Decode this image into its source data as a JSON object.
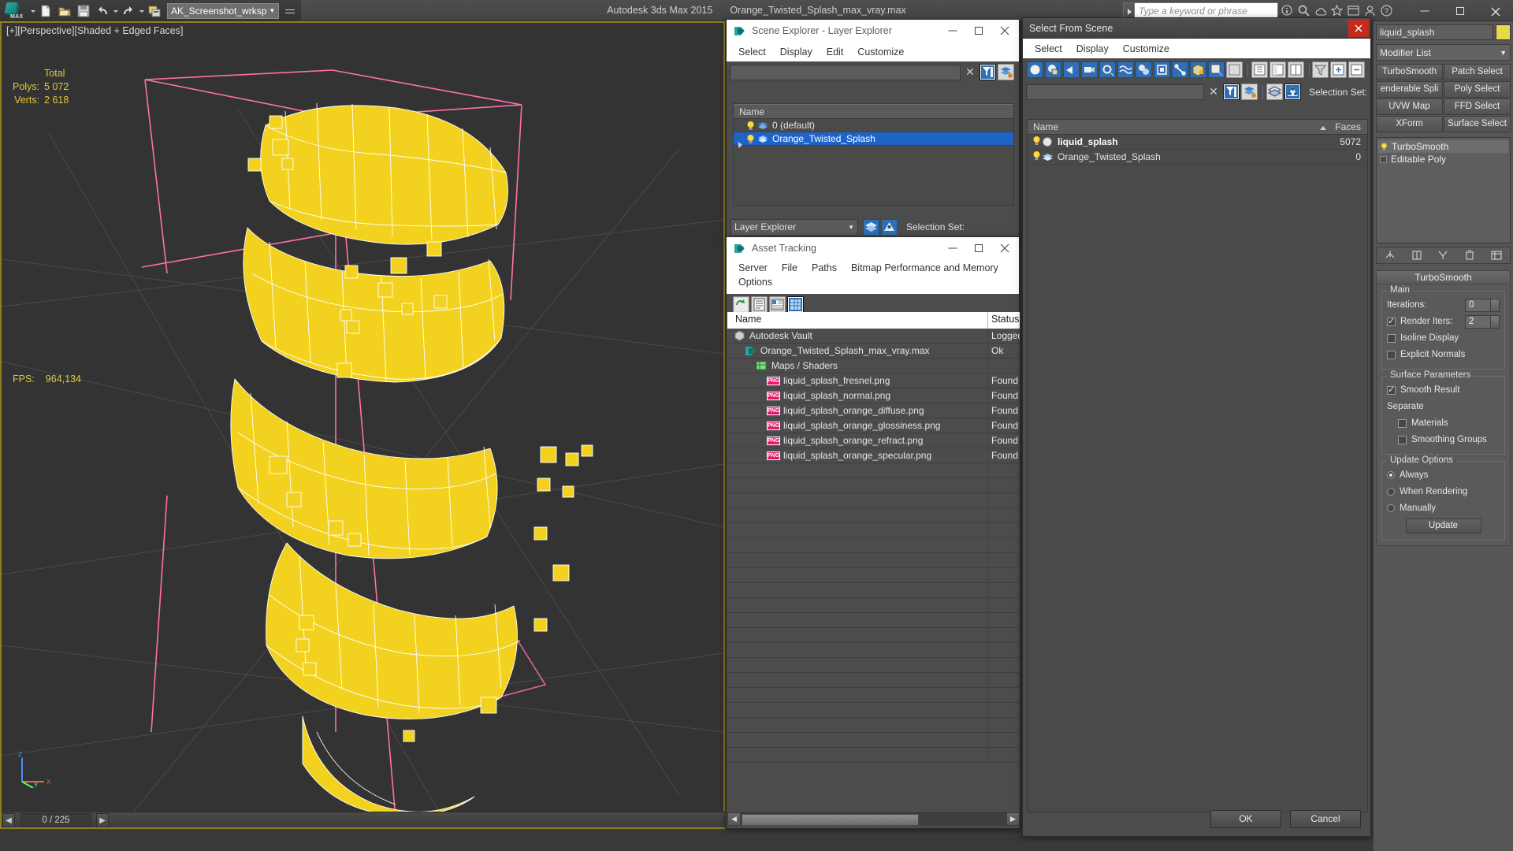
{
  "app": {
    "title": "Autodesk 3ds Max  2015",
    "file_name": "Orange_Twisted_Splash_max_vray.max",
    "workspace": "AK_Screenshot_wrksp",
    "search_placeholder": "Type a keyword or phrase"
  },
  "viewport": {
    "label": "[+][Perspective][Shaded + Edged Faces]",
    "stats_header": "Total",
    "polys_label": "Polys:",
    "polys_value": "5 072",
    "verts_label": "Verts:",
    "verts_value": "2 618",
    "fps_label": "FPS:",
    "fps_value": "964,134",
    "axis_z": "Z",
    "axis_x": "X",
    "axis_y": "Y",
    "status_count": "0 / 225",
    "prev_arrow": "◀",
    "next_arrow": "▶"
  },
  "scene_explorer": {
    "title": "Scene Explorer - Layer Explorer",
    "menus": [
      "Select",
      "Display",
      "Edit",
      "Customize"
    ],
    "search_value": "",
    "columns": [
      "Name"
    ],
    "rows": [
      {
        "name": "0 (default)",
        "selected": false,
        "expandable": false
      },
      {
        "name": "Orange_Twisted_Splash",
        "selected": true,
        "expandable": true
      }
    ],
    "footer_combo": "Layer Explorer",
    "selection_set_label": "Selection Set:",
    "min_label": "minimize",
    "max_label": "maximize",
    "close_label": "close"
  },
  "asset_tracking": {
    "title": "Asset Tracking",
    "menus": [
      "Server",
      "File",
      "Paths",
      "Bitmap Performance and Memory",
      "Options"
    ],
    "columns": [
      "Name",
      "Status"
    ],
    "rows": [
      {
        "name": "Autodesk Vault",
        "status": "Logged",
        "icon": "vault-icon",
        "indent": 0
      },
      {
        "name": "Orange_Twisted_Splash_max_vray.max",
        "status": "Ok",
        "icon": "max-file-icon",
        "indent": 1
      },
      {
        "name": "Maps / Shaders",
        "status": "",
        "icon": "maps-icon",
        "indent": 2
      },
      {
        "name": "liquid_splash_fresnel.png",
        "status": "Found",
        "icon": "png-icon",
        "indent": 3
      },
      {
        "name": "liquid_splash_normal.png",
        "status": "Found",
        "icon": "png-icon",
        "indent": 3
      },
      {
        "name": "liquid_splash_orange_diffuse.png",
        "status": "Found",
        "icon": "png-icon",
        "indent": 3
      },
      {
        "name": "liquid_splash_orange_glossiness.png",
        "status": "Found",
        "icon": "png-icon",
        "indent": 3
      },
      {
        "name": "liquid_splash_orange_refract.png",
        "status": "Found",
        "icon": "png-icon",
        "indent": 3
      },
      {
        "name": "liquid_splash_orange_specular.png",
        "status": "Found",
        "icon": "png-icon",
        "indent": 3
      }
    ],
    "empty_rows": 20
  },
  "select_from_scene": {
    "title": "Select From Scene",
    "menus": [
      "Select",
      "Display",
      "Customize"
    ],
    "search_value": "",
    "selection_set_label": "Selection Set:",
    "columns": [
      "Name",
      "Faces"
    ],
    "rows": [
      {
        "name": "liquid_splash",
        "faces": "5072",
        "bold": true
      },
      {
        "name": "Orange_Twisted_Splash",
        "faces": "0",
        "bold": false
      }
    ],
    "ok_label": "OK",
    "cancel_label": "Cancel",
    "close_label": "close"
  },
  "command_panel": {
    "object_name": "liquid_splash",
    "object_color": "#e9d84a",
    "modifier_list_label": "Modifier List",
    "buttons": [
      [
        "TurboSmooth",
        "Patch Select"
      ],
      [
        "enderable Spli",
        "Poly Select"
      ],
      [
        "UVW Map",
        "FFD Select"
      ],
      [
        "XForm",
        "Surface Select"
      ]
    ],
    "stack": [
      {
        "label": "TurboSmooth",
        "selected": true
      },
      {
        "label": "Editable Poly",
        "selected": false
      }
    ],
    "rollup_title": "TurboSmooth",
    "groups": {
      "main": {
        "label": "Main",
        "iterations_label": "Iterations:",
        "iterations_value": "0",
        "render_iters_label": "Render Iters:",
        "render_iters_value": "2",
        "render_iters_checked": true,
        "isoline_label": "Isoline Display",
        "isoline_checked": false,
        "explicit_label": "Explicit Normals",
        "explicit_checked": false
      },
      "surface_parameters": {
        "label": "Surface Parameters",
        "smooth_result_label": "Smooth Result",
        "smooth_result_checked": true,
        "separate_label": "Separate",
        "materials_label": "Materials",
        "materials_checked": false,
        "smoothing_groups_label": "Smoothing Groups",
        "smoothing_groups_checked": false
      },
      "update_options": {
        "label": "Update Options",
        "always_label": "Always",
        "when_rendering_label": "When Rendering",
        "manually_label": "Manually",
        "selected": "Always",
        "update_button": "Update"
      }
    }
  },
  "colors": {
    "accent_blue": "#1e64c8",
    "viewport_border": "#8e7f24",
    "mesh_yellow": "#f2d21e",
    "mesh_wire": "#ffffff",
    "helper_pink": "#ff6fae",
    "stat_yellow": "#e2c73a",
    "panel_gray": "#4c4c4c"
  }
}
